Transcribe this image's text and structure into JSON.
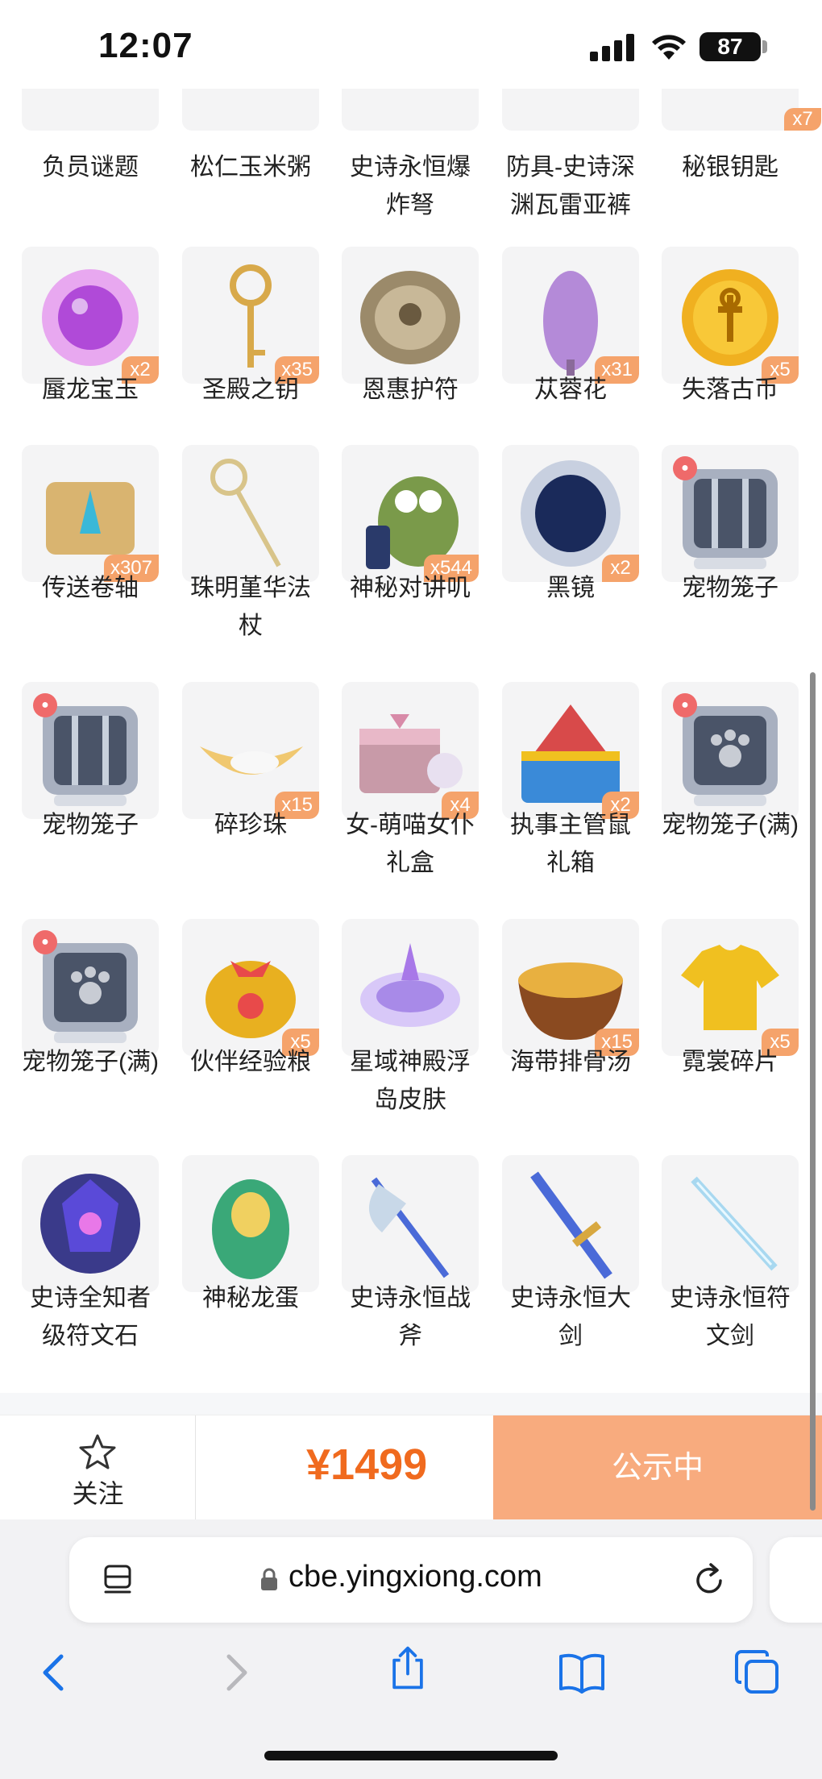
{
  "status": {
    "time": "12:07",
    "battery": "87"
  },
  "items_top_row": [
    {
      "name": "负员谜题",
      "badge": ""
    },
    {
      "name": "松仁玉米粥",
      "badge": ""
    },
    {
      "name": "史诗永恒爆炸弩",
      "badge": ""
    },
    {
      "name": "防具-史诗深渊瓦雷亚裤",
      "badge": ""
    },
    {
      "name": "秘银钥匙",
      "badge": "x7"
    }
  ],
  "items": [
    {
      "name": "蜃龙宝玉",
      "badge": "x2",
      "icon": "purple-orb-icon",
      "color": "#b04ad8"
    },
    {
      "name": "圣殿之钥",
      "badge": "x35",
      "icon": "golden-key-icon",
      "color": "#d8a94a"
    },
    {
      "name": "恩惠护符",
      "badge": "",
      "icon": "stone-amulet-icon",
      "color": "#9b8a6a"
    },
    {
      "name": "苁蓉花",
      "badge": "x31",
      "icon": "purple-flower-icon",
      "color": "#b48ad8"
    },
    {
      "name": "失落古币",
      "badge": "x5",
      "icon": "gold-coin-icon",
      "color": "#f0b020"
    },
    {
      "name": "传送卷轴",
      "badge": "x307",
      "icon": "scroll-icon",
      "color": "#d9b470"
    },
    {
      "name": "珠明堇华法杖",
      "badge": "",
      "icon": "staff-icon",
      "color": "#d8c48a"
    },
    {
      "name": "神秘对讲叽",
      "badge": "x544",
      "icon": "bird-radio-icon",
      "color": "#7a9a4a"
    },
    {
      "name": "黑镜",
      "badge": "x2",
      "icon": "black-mirror-icon",
      "color": "#1a2a5a"
    },
    {
      "name": "宠物笼子",
      "badge": "",
      "icon": "pet-cage-icon",
      "color": "#4a5468"
    },
    {
      "name": "宠物笼子",
      "badge": "",
      "icon": "pet-cage-icon",
      "color": "#4a5468"
    },
    {
      "name": "碎珍珠",
      "badge": "x15",
      "icon": "pearl-shell-icon",
      "color": "#f0c870"
    },
    {
      "name": "女-萌喵女仆礼盒",
      "badge": "x4",
      "icon": "gift-box-icon",
      "color": "#d88aa8"
    },
    {
      "name": "执事主管鼠礼箱",
      "badge": "x2",
      "icon": "blue-chest-icon",
      "color": "#3a8ad8"
    },
    {
      "name": "宠物笼子(满)",
      "badge": "",
      "icon": "pet-cage-full-icon",
      "color": "#4a5468"
    },
    {
      "name": "宠物笼子(满)",
      "badge": "",
      "icon": "pet-cage-full-icon",
      "color": "#4a5468"
    },
    {
      "name": "伙伴经验粮",
      "badge": "x5",
      "icon": "food-bag-icon",
      "color": "#e8b020"
    },
    {
      "name": "星域神殿浮岛皮肤",
      "badge": "",
      "icon": "floating-island-icon",
      "color": "#a88ae8"
    },
    {
      "name": "海带排骨汤",
      "badge": "x15",
      "icon": "soup-bowl-icon",
      "color": "#e8b040"
    },
    {
      "name": "霓裳碎片",
      "badge": "x5",
      "icon": "shirt-icon",
      "color": "#f0c020"
    },
    {
      "name": "史诗全知者级符文石",
      "badge": "",
      "icon": "rune-stone-icon",
      "color": "#5a4ad8"
    },
    {
      "name": "神秘龙蛋",
      "badge": "",
      "icon": "dragon-egg-icon",
      "color": "#3aa878"
    },
    {
      "name": "史诗永恒战斧",
      "badge": "",
      "icon": "battle-axe-icon",
      "color": "#c8d8e8"
    },
    {
      "name": "史诗永恒大剑",
      "badge": "",
      "icon": "great-sword-icon",
      "color": "#4a6ad8"
    },
    {
      "name": "史诗永恒符文剑",
      "badge": "",
      "icon": "rune-sword-icon",
      "color": "#a8d8f0"
    }
  ],
  "action_bar": {
    "follow_label": "关注",
    "price": "¥1499",
    "status_label": "公示中"
  },
  "browser": {
    "url": "cbe.yingxiong.com"
  },
  "colors": {
    "accent": "#f06a1e",
    "status_button": "#f8ab7e",
    "badge": "#f5a36b"
  }
}
